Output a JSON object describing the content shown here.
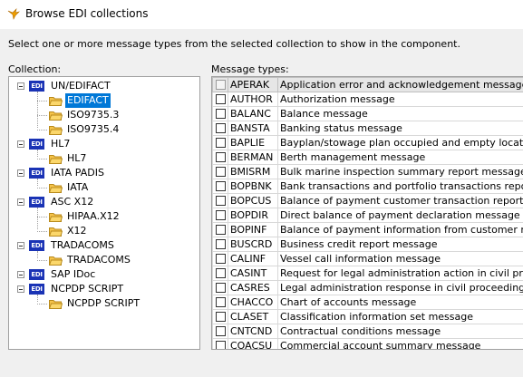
{
  "window": {
    "title": "Browse EDI collections"
  },
  "instructions": "Select one or more message types from the selected collection to show in the component.",
  "collection_label": "Collection:",
  "message_types_label": "Message types:",
  "tree": {
    "edi_icon_text": "EDI",
    "groups": [
      {
        "label": "UN/EDIFACT",
        "children": [
          {
            "label": "EDIFACT",
            "selected": true
          },
          {
            "label": "ISO9735.3"
          },
          {
            "label": "ISO9735.4"
          }
        ]
      },
      {
        "label": "HL7",
        "children": [
          {
            "label": "HL7"
          }
        ]
      },
      {
        "label": "IATA PADIS",
        "children": [
          {
            "label": "IATA"
          }
        ]
      },
      {
        "label": "ASC X12",
        "children": [
          {
            "label": "HIPAA.X12"
          },
          {
            "label": "X12"
          }
        ]
      },
      {
        "label": "TRADACOMS",
        "children": [
          {
            "label": "TRADACOMS"
          }
        ]
      },
      {
        "label": "SAP IDoc",
        "children": []
      },
      {
        "label": "NCPDP SCRIPT",
        "children": [
          {
            "label": "NCPDP SCRIPT"
          }
        ]
      }
    ]
  },
  "messages": [
    {
      "code": "APERAK",
      "desc": "Application error and acknowledgement message"
    },
    {
      "code": "AUTHOR",
      "desc": "Authorization message"
    },
    {
      "code": "BALANC",
      "desc": "Balance message"
    },
    {
      "code": "BANSTA",
      "desc": "Banking status message"
    },
    {
      "code": "BAPLIE",
      "desc": "Bayplan/stowage plan occupied and empty locations message"
    },
    {
      "code": "BERMAN",
      "desc": "Berth management message"
    },
    {
      "code": "BMISRM",
      "desc": "Bulk marine inspection summary report message"
    },
    {
      "code": "BOPBNK",
      "desc": "Bank transactions and portfolio transactions report message"
    },
    {
      "code": "BOPCUS",
      "desc": "Balance of payment customer transaction report message"
    },
    {
      "code": "BOPDIR",
      "desc": "Direct balance of payment declaration message"
    },
    {
      "code": "BOPINF",
      "desc": "Balance of payment information from customer message"
    },
    {
      "code": "BUSCRD",
      "desc": "Business credit report message"
    },
    {
      "code": "CALINF",
      "desc": "Vessel call information message"
    },
    {
      "code": "CASINT",
      "desc": "Request for legal administration action in civil proceedings message"
    },
    {
      "code": "CASRES",
      "desc": "Legal administration response in civil proceedings message"
    },
    {
      "code": "CHACCO",
      "desc": "Chart of accounts message"
    },
    {
      "code": "CLASET",
      "desc": "Classification information set message"
    },
    {
      "code": "CNTCND",
      "desc": "Contractual conditions message"
    },
    {
      "code": "COACSU",
      "desc": "Commercial account summary message"
    }
  ]
}
